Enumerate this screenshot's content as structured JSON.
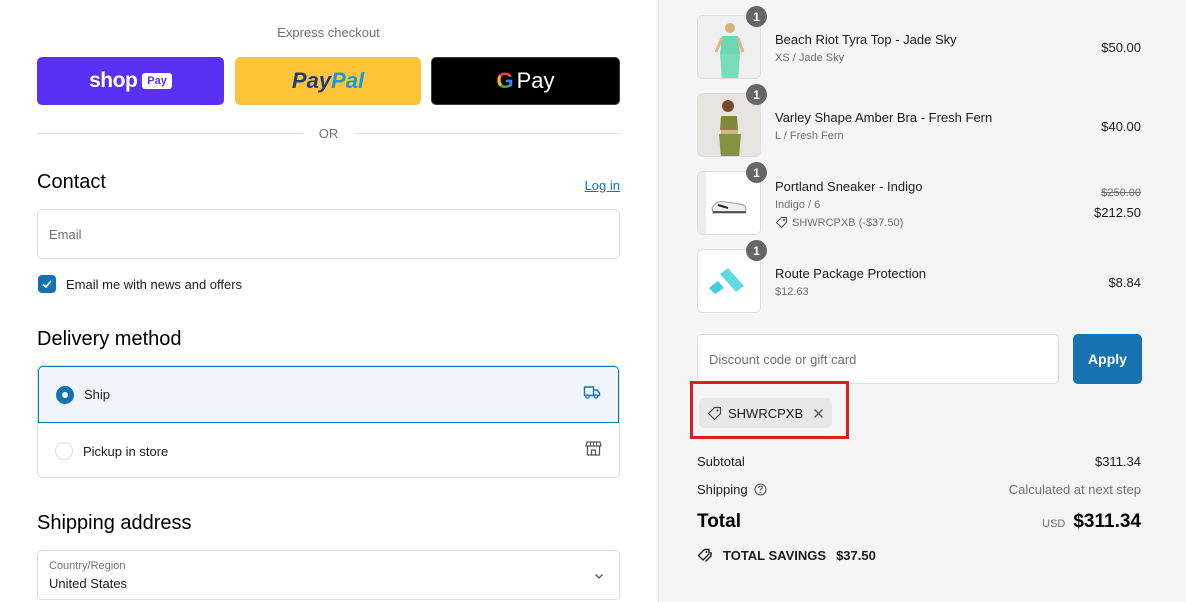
{
  "express": {
    "title": "Express checkout",
    "shop_pay": {
      "word": "shop",
      "tag": "Pay"
    },
    "paypal": {
      "part1": "Pay",
      "part2": "Pal"
    },
    "gpay": {
      "g": "G",
      "word": "Pay"
    },
    "or_label": "OR"
  },
  "contact": {
    "heading": "Contact",
    "login_label": "Log in",
    "email_placeholder": "Email",
    "email_value": "",
    "newsletter_label": "Email me with news and offers",
    "newsletter_checked": true
  },
  "delivery": {
    "heading": "Delivery method",
    "options": [
      {
        "label": "Ship",
        "icon": "truck-icon",
        "selected": true
      },
      {
        "label": "Pickup in store",
        "icon": "store-icon",
        "selected": false
      }
    ]
  },
  "shipping": {
    "heading": "Shipping address",
    "country_label": "Country/Region",
    "country_value": "United States"
  },
  "cart": {
    "items": [
      {
        "name": "Beach Riot Tyra Top - Jade Sky",
        "variant": "XS / Jade Sky",
        "qty": "1",
        "price": "$50.00"
      },
      {
        "name": "Varley Shape Amber Bra - Fresh Fern",
        "variant": "L / Fresh Fern",
        "qty": "1",
        "price": "$40.00"
      },
      {
        "name": "Portland Sneaker - Indigo",
        "variant": "Indigo / 6",
        "discount": "SHWRCPXB (-$37.50)",
        "qty": "1",
        "original_price": "$250.00",
        "price": "$212.50"
      },
      {
        "name": "Route Package Protection",
        "variant": "$12.63",
        "qty": "1",
        "price": "$8.84"
      }
    ],
    "discount_placeholder": "Discount code or gift card",
    "apply_label": "Apply",
    "applied_code": "SHWRCPXB",
    "subtotal_label": "Subtotal",
    "subtotal_value": "$311.34",
    "shipping_label": "Shipping",
    "shipping_value": "Calculated at next step",
    "total_label": "Total",
    "currency": "USD",
    "total_value": "$311.34",
    "savings_label": "TOTAL SAVINGS",
    "savings_value": "$37.50"
  },
  "colors": {
    "accent": "#1773b0",
    "shop_pay": "#5a31f4",
    "paypal": "#ffc439",
    "highlight": "#e01b24"
  }
}
